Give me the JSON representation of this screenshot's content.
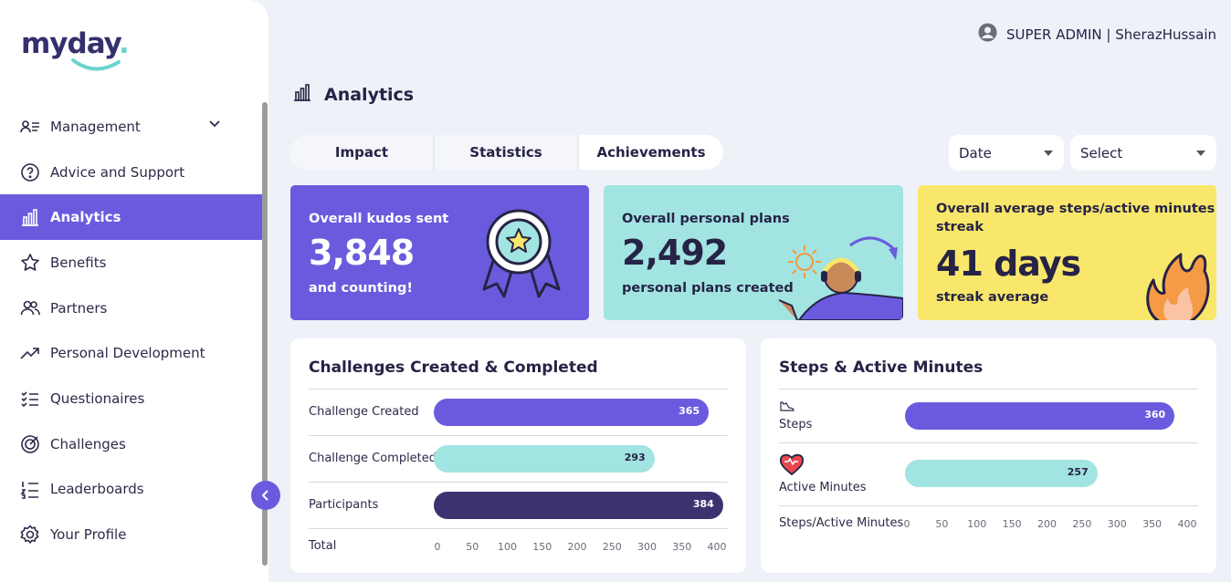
{
  "app": {
    "logo": "myday",
    "logo_dot": "."
  },
  "user": {
    "label": "SUPER ADMIN | SherazHussain"
  },
  "sidebar": {
    "items": [
      {
        "label": "Management",
        "icon": "users-list-icon"
      },
      {
        "label": "Advice and Support",
        "icon": "help-circle-icon"
      },
      {
        "label": "Analytics",
        "icon": "bar-chart-icon"
      },
      {
        "label": "Benefits",
        "icon": "star-icon"
      },
      {
        "label": "Partners",
        "icon": "people-icon"
      },
      {
        "label": "Personal Development",
        "icon": "trending-up-icon"
      },
      {
        "label": "Questionaires",
        "icon": "checklist-icon"
      },
      {
        "label": "Challenges",
        "icon": "target-icon"
      },
      {
        "label": "Leaderboards",
        "icon": "numbered-list-icon"
      },
      {
        "label": "Your Profile",
        "icon": "gear-icon"
      }
    ],
    "active": "Analytics"
  },
  "page": {
    "title": "Analytics"
  },
  "tabs": [
    "Impact",
    "Statistics",
    "Achievements"
  ],
  "filters": {
    "date": "Date",
    "select": "Select"
  },
  "stats": {
    "kudos": {
      "label": "Overall kudos sent",
      "value": "3,848",
      "sub": "and counting!"
    },
    "plans": {
      "label": "Overall personal plans",
      "value": "2,492",
      "sub": "personal plans created"
    },
    "streak": {
      "label_line1": "Overall average steps/active minutes",
      "label_line2": "streak",
      "value": "41 days",
      "sub": "streak average"
    }
  },
  "challenges_panel": {
    "title": "Challenges Created & Completed",
    "footer_label": "Total"
  },
  "steps_panel": {
    "title": "Steps & Active Minutes",
    "footer_label": "Steps/Active Minutes"
  },
  "chart_data": [
    {
      "type": "bar",
      "orientation": "horizontal",
      "title": "Challenges Created & Completed",
      "categories": [
        "Challenge Created",
        "Challenge Completed",
        "Participants"
      ],
      "values": [
        365,
        293,
        384
      ],
      "value_labels": [
        "365",
        "293",
        "384"
      ],
      "colors": [
        "#6a5bde",
        "#a2e4e1",
        "#3b3370"
      ],
      "xlabel": "Total",
      "ticks": [
        "0",
        "50",
        "100",
        "150",
        "200",
        "250",
        "300",
        "350",
        "400"
      ],
      "xlim": [
        0,
        400
      ]
    },
    {
      "type": "bar",
      "orientation": "horizontal",
      "title": "Steps & Active Minutes",
      "categories": [
        "Steps",
        "Active Minutes"
      ],
      "values": [
        360,
        257
      ],
      "value_labels": [
        "360",
        "257"
      ],
      "colors": [
        "#6a5bde",
        "#a2e4e1"
      ],
      "xlabel": "Steps/Active Minutes",
      "ticks": [
        "0",
        "50",
        "100",
        "150",
        "200",
        "250",
        "300",
        "350",
        "400"
      ],
      "xlim": [
        0,
        400
      ]
    }
  ]
}
